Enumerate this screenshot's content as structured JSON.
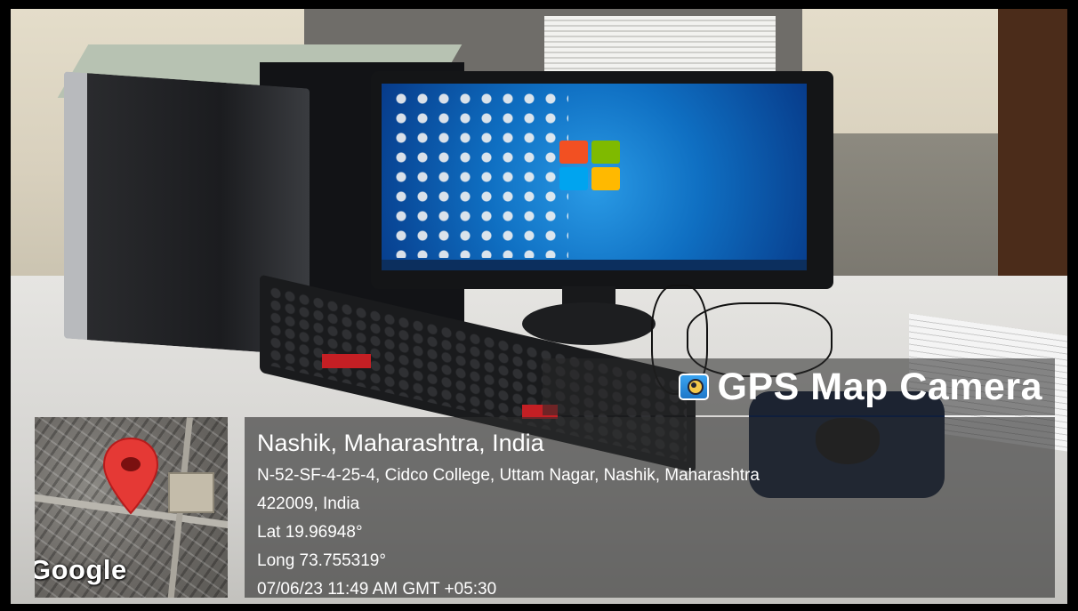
{
  "overlay": {
    "app_title": "GPS Map Camera",
    "app_icon": "gps-map-camera-icon",
    "place": "Nashik, Maharashtra, India",
    "address_line1": "N-52-SF-4-25-4, Cidco College, Uttam Nagar, Nashik, Maharashtra",
    "address_line2": "422009, India",
    "latitude": "Lat 19.96948°",
    "longitude": "Long 73.755319°",
    "datetime": "07/06/23 11:49 AM GMT +05:30"
  },
  "minimap": {
    "attribution": "Google",
    "pin_icon": "map-pin-icon",
    "pin_color": "#e53935"
  },
  "scene": {
    "screen_color": "#1577d3"
  }
}
